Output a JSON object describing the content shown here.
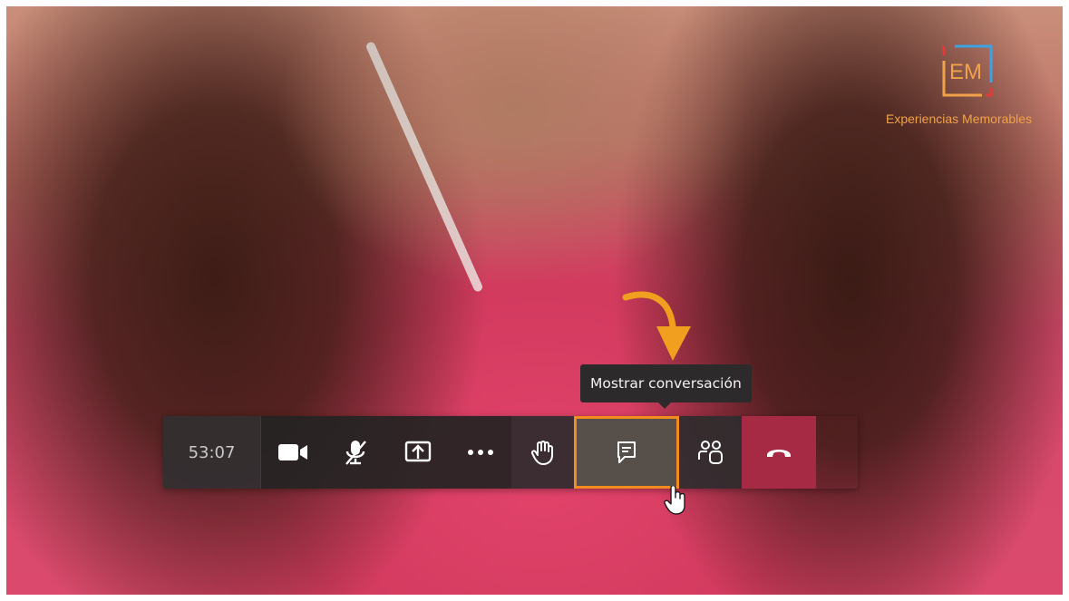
{
  "brand": {
    "logo_letters": "EM",
    "name": "Experiencias Memorables",
    "colors": {
      "orange": "#f0a24a",
      "red": "#e23b3b",
      "blue": "#3aa3e0"
    }
  },
  "tooltip": {
    "text": "Mostrar conversación"
  },
  "toolbar": {
    "timer": "53:07",
    "buttons": [
      {
        "id": "camera",
        "icon": "video-camera-icon"
      },
      {
        "id": "mic",
        "icon": "microphone-muted-icon"
      },
      {
        "id": "share",
        "icon": "share-screen-icon"
      },
      {
        "id": "more",
        "icon": "more-options-icon"
      },
      {
        "id": "raise-hand",
        "icon": "raise-hand-icon"
      },
      {
        "id": "chat",
        "icon": "chat-icon",
        "highlighted": true
      },
      {
        "id": "participants",
        "icon": "participants-icon"
      },
      {
        "id": "hang-up",
        "icon": "hang-up-icon"
      }
    ],
    "colors": {
      "highlight": "#f28c1e",
      "hangup": "#a62a44"
    }
  }
}
